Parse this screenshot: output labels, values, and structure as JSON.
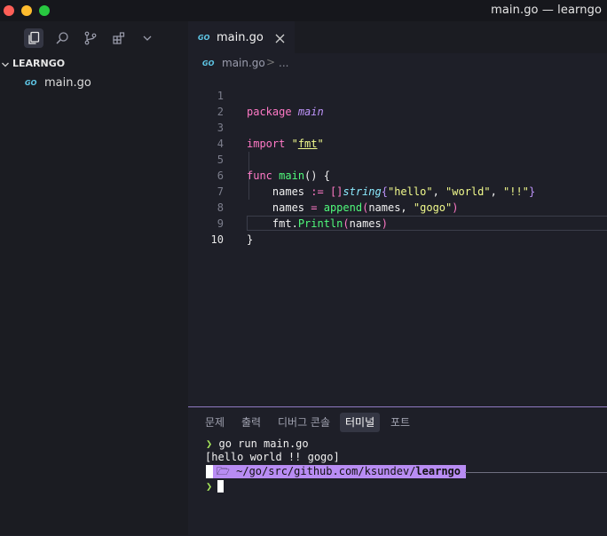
{
  "window": {
    "title": "main.go — learngo"
  },
  "activity_bar": {
    "icons": [
      "explorer-icon",
      "search-icon",
      "source-control-icon",
      "extensions-icon",
      "more-chevron-icon"
    ]
  },
  "explorer": {
    "section_title": "LEARNGO",
    "files": [
      {
        "badge": "GO",
        "name": "main.go"
      }
    ]
  },
  "editor": {
    "tab": {
      "badge": "GO",
      "label": "main.go"
    },
    "breadcrumb": {
      "badge": "GO",
      "file": "main.go",
      "separator": ">",
      "more": "..."
    },
    "line_numbers": [
      "1",
      "2",
      "3",
      "4",
      "5",
      "6",
      "7",
      "8",
      "9",
      "10"
    ],
    "current_line": "10",
    "code": {
      "l1_kw": "package",
      "l1_name": "main",
      "l3_kw": "import",
      "l3_q1": "\"",
      "l3_pkg": "fmt",
      "l3_q2": "\"",
      "l5_kw": "func",
      "l5_name": "main",
      "l5_rest": "() {",
      "l6_indent": "    ",
      "l6_var": "names",
      "l6_op": " := ",
      "l6_br": "[]",
      "l6_type": "string",
      "l6_ob": "{",
      "l6_s1": "\"hello\"",
      "l6_c1": ", ",
      "l6_s2": "\"world\"",
      "l6_c2": ", ",
      "l6_s3": "\"!!\"",
      "l6_cb": "}",
      "l7_indent": "    ",
      "l7_var": "names",
      "l7_op": " = ",
      "l7_fn": "append",
      "l7_op2": "(",
      "l7_args": "names, ",
      "l7_s": "\"gogo\"",
      "l7_cp": ")",
      "l8_indent": "    ",
      "l8_pkg": "fmt.",
      "l8_fn": "Println",
      "l8_op": "(",
      "l8_arg": "names",
      "l8_cp": ")",
      "l9": "}"
    }
  },
  "panel": {
    "tabs": [
      "문제",
      "출력",
      "디버그 콘솔",
      "터미널",
      "포트"
    ],
    "active_tab": "터미널",
    "terminal": {
      "prompt_symbol": "❯",
      "command": "go run main.go",
      "output": "[hello world !! gogo]",
      "apple_glyph": "",
      "folder_glyph": "🗁",
      "path_prefix": "~/go/src/github.com/ksundev/",
      "path_dir": "learngo"
    }
  },
  "colors": {
    "keyword": "#ff79c6",
    "function": "#50fa7b",
    "string": "#f1fa8c",
    "type": "#8be9fd",
    "identifier": "#bd93f9",
    "prompt": "#a4e35a",
    "path_bg": "#b88cf3"
  }
}
